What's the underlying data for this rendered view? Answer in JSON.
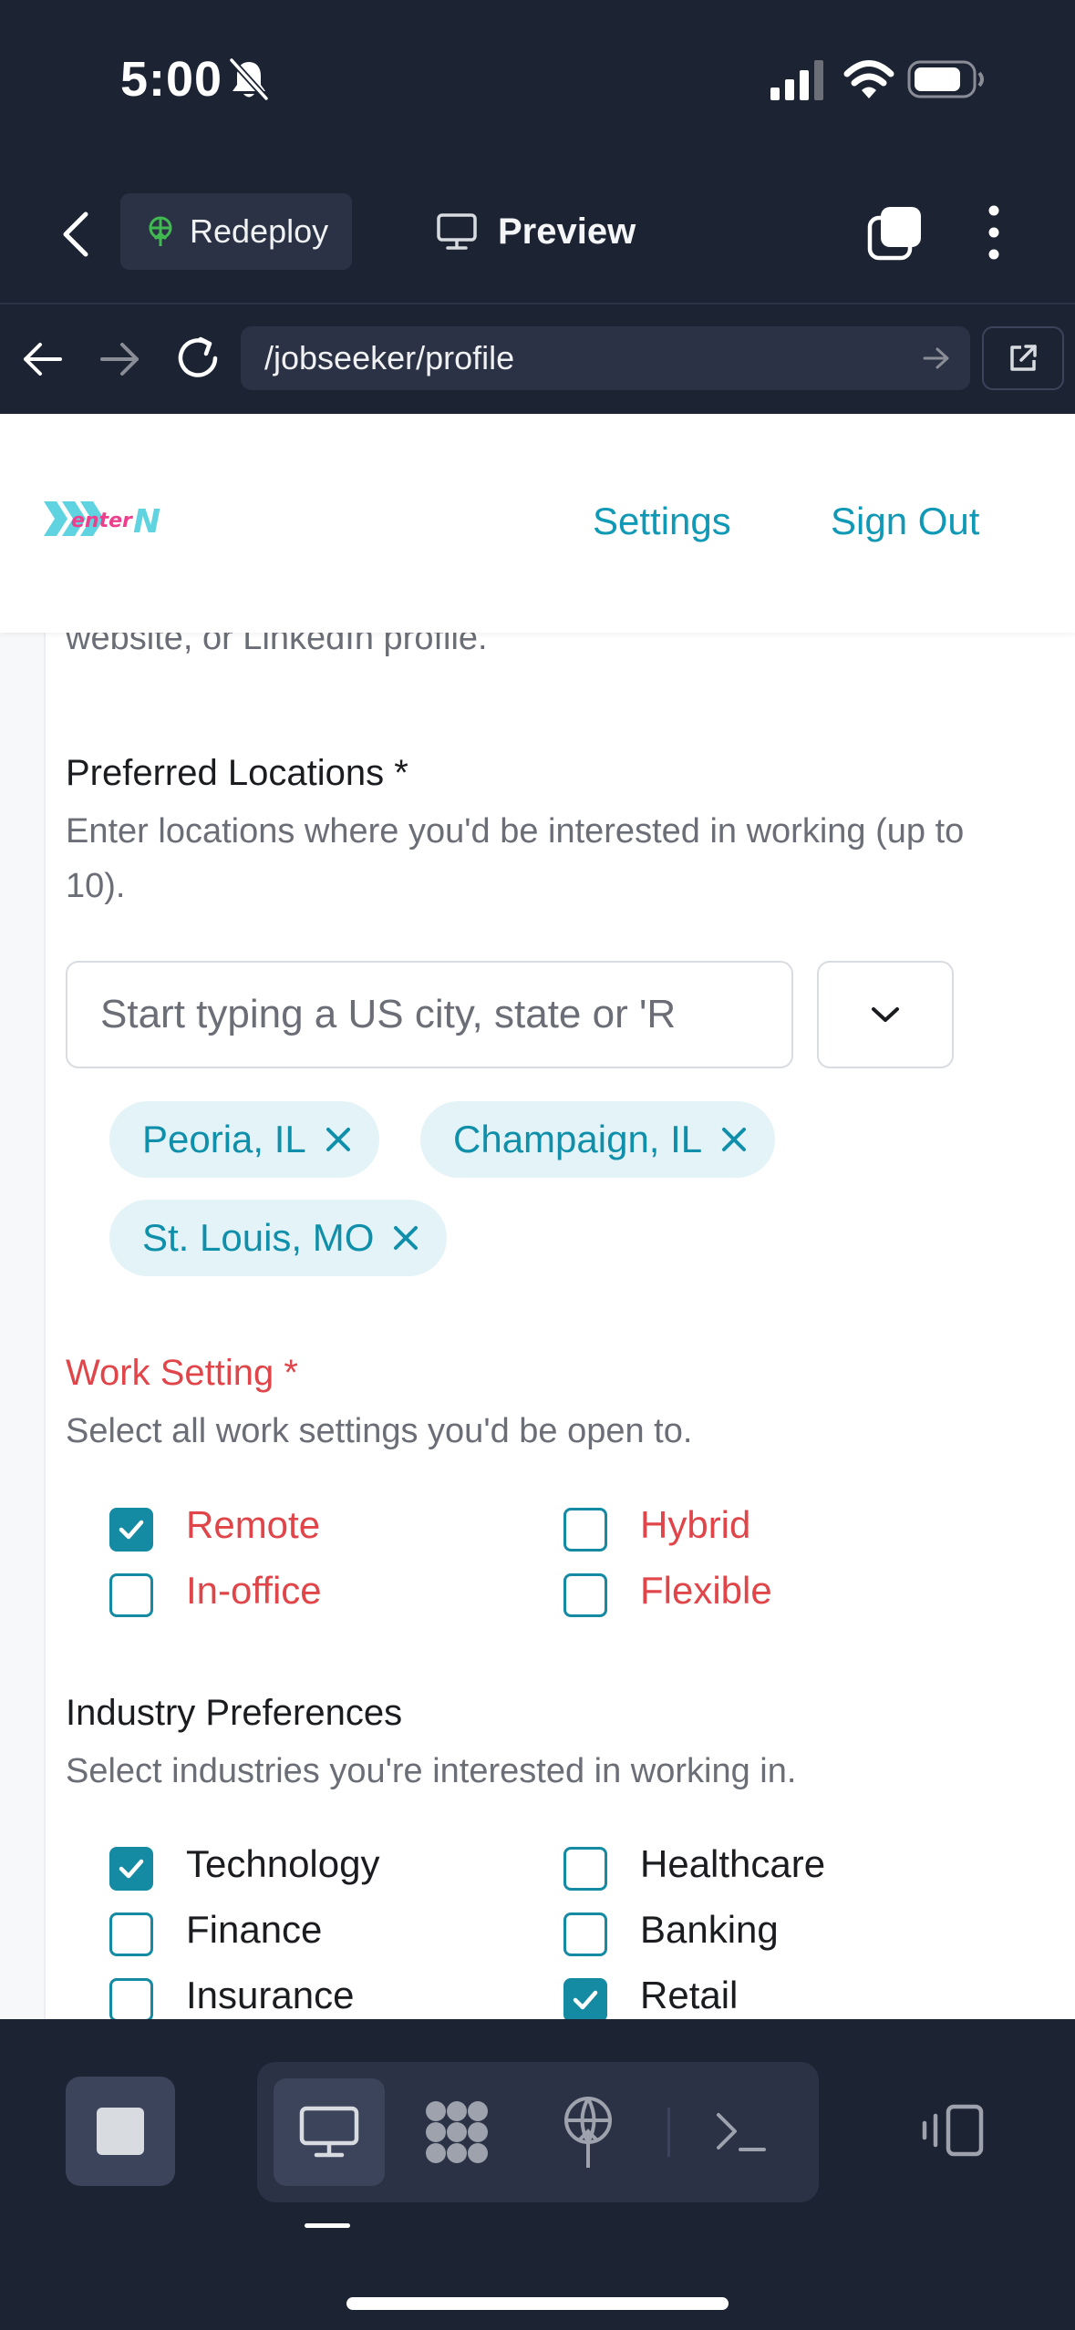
{
  "status_bar": {
    "time": "5:00",
    "icons": [
      "bell-slash-icon",
      "signal-icon",
      "wifi-icon",
      "battery-icon"
    ]
  },
  "toolbar": {
    "redeploy_label": "Redeploy",
    "preview_label": "Preview"
  },
  "url_bar": {
    "path": "/jobseeker/profile"
  },
  "site": {
    "logo_text": "enterN",
    "nav": {
      "settings": "Settings",
      "sign_out": "Sign Out"
    }
  },
  "form": {
    "faded_text": "website, or LinkedIn profile.",
    "locations": {
      "title": "Preferred Locations *",
      "description": "Enter locations where you'd be interested in working (up to 10).",
      "placeholder": "Start typing a US city, state or 'R",
      "chips": [
        "Peoria, IL",
        "Champaign, IL",
        "St. Louis, MO"
      ]
    },
    "work_setting": {
      "title": "Work Setting *",
      "description": "Select all work settings you'd be open to.",
      "options": [
        {
          "label": "Remote",
          "checked": true
        },
        {
          "label": "Hybrid",
          "checked": false
        },
        {
          "label": "In-office",
          "checked": false
        },
        {
          "label": "Flexible",
          "checked": false
        }
      ]
    },
    "industry": {
      "title": "Industry Preferences",
      "description": "Select industries you're interested in working in.",
      "options": [
        {
          "label": "Technology",
          "checked": true
        },
        {
          "label": "Healthcare",
          "checked": false
        },
        {
          "label": "Finance",
          "checked": false
        },
        {
          "label": "Banking",
          "checked": false
        },
        {
          "label": "Insurance",
          "checked": false
        },
        {
          "label": "Retail",
          "checked": true
        }
      ]
    }
  },
  "colors": {
    "accent": "#148aa3",
    "link": "#0f99b6",
    "error": "#e0454a",
    "chip_bg": "#e3f3f7",
    "chrome_bg": "#1c2333"
  }
}
